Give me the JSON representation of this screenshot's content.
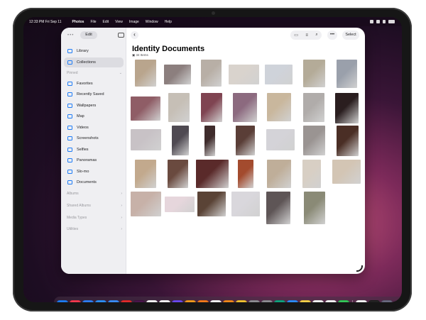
{
  "menubar": {
    "clock": "12:33 PM  Fri Sep 11",
    "app": "Photos",
    "items": [
      "File",
      "Edit",
      "View",
      "Image",
      "Window",
      "Help"
    ]
  },
  "sidebar": {
    "edit_label": "Edit",
    "items": [
      {
        "label": "Library"
      },
      {
        "label": "Collections"
      }
    ],
    "sections": [
      "Pinned",
      "Albums",
      "Shared Albums",
      "Media Types",
      "Utilities"
    ],
    "pinned": [
      "Favorites",
      "Recently Saved",
      "Wallpapers",
      "Map",
      "Videos",
      "Screenshots",
      "Selfies",
      "Panoramas",
      "Slo-mo",
      "Documents"
    ]
  },
  "main": {
    "title": "Identity Documents",
    "item_count": "34 Items",
    "select_label": "Select"
  },
  "photos": {
    "colors": [
      "#b9a58d",
      "#8c7f7e",
      "#b8afa6",
      "#d9d3cd",
      "#cfd3da",
      "#b4ab98",
      "#9aa0ab",
      "#8f5d66",
      "#c6bfb6",
      "#7f4451",
      "#8c6a7f",
      "#c9b79d",
      "#b0acaa",
      "#2a1e1f",
      "#c8c2c6",
      "#4f4a52",
      "#3f2c2c",
      "#5a3e37",
      "#d4d3d8",
      "#9a9492",
      "#4a2e25",
      "#c2a98d",
      "#6a4a3f",
      "#5a2a2a",
      "#a34b2e",
      "#bfae99",
      "#d8cfc4",
      "#d3c5b4",
      "#c7b1a8",
      "#e6d6dc",
      "#5a4336",
      "#d9d7dc",
      "#5e5556",
      "#8a8a76"
    ]
  },
  "dock": {
    "apps": [
      {
        "name": "app-store-icon",
        "color": "#1f7cf0"
      },
      {
        "name": "music-icon",
        "color": "#f2394e"
      },
      {
        "name": "files-icon",
        "color": "#2f7ef4"
      },
      {
        "name": "safari-icon",
        "color": "#2d8ff6"
      },
      {
        "name": "mail-icon",
        "color": "#3a8cf5"
      },
      {
        "name": "youtube-icon",
        "color": "#e22b2b"
      },
      {
        "name": "slack-icon",
        "color": "#4a154b"
      },
      {
        "name": "calendar-icon",
        "color": "#ffffff"
      },
      {
        "name": "reminders-icon",
        "color": "#ffffff"
      },
      {
        "name": "shortcuts-icon",
        "color": "#6b4af0"
      },
      {
        "name": "pages-icon",
        "color": "#f39a1e"
      },
      {
        "name": "keynote-icon",
        "color": "#f47a1c"
      },
      {
        "name": "notion-icon",
        "color": "#ffffff"
      },
      {
        "name": "books-icon",
        "color": "#f3891c"
      },
      {
        "name": "photos-icon",
        "color": "#f1c232"
      },
      {
        "name": "camera-app-icon",
        "color": "#8e8e93"
      },
      {
        "name": "settings-icon",
        "color": "#8e8e93"
      },
      {
        "name": "chatgpt-icon",
        "color": "#10a37f"
      },
      {
        "name": "zoom-icon",
        "color": "#2d8cff"
      },
      {
        "name": "notes-icon",
        "color": "#f7d14a"
      },
      {
        "name": "freeform-icon",
        "color": "#ffffff"
      },
      {
        "name": "icloud-icon",
        "color": "#ffffff"
      },
      {
        "name": "messages-icon",
        "color": "#34c759"
      },
      {
        "name": "slack-2-icon",
        "color": "#ffffff"
      },
      {
        "name": "reeder-icon",
        "color": "#222222"
      },
      {
        "name": "app-library-icon",
        "color": "#6a6a80"
      }
    ]
  }
}
